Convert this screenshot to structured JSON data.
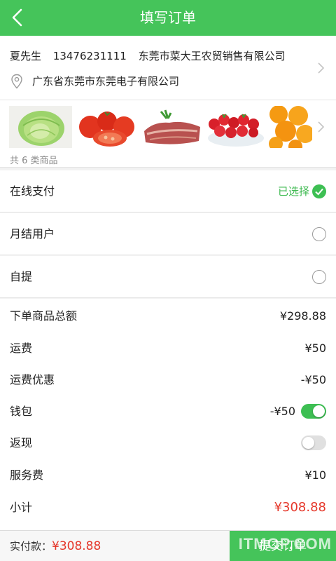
{
  "header": {
    "title": "填写订单",
    "back_icon": "chevron-left-icon"
  },
  "address": {
    "name": "夏先生",
    "phone": "13476231111",
    "company": "东莞市菜大王农贸销售有限公司",
    "location": "广东省东莞市东莞电子有限公司"
  },
  "goods": {
    "items": [
      "cabbage",
      "tomatoes",
      "pork",
      "strawberries",
      "oranges"
    ],
    "count_text": "共 6 类商品"
  },
  "payment_options": [
    {
      "label": "在线支付",
      "status": "已选择",
      "selected": true
    },
    {
      "label": "月结用户",
      "selected": false
    },
    {
      "label": "自提",
      "selected": false
    }
  ],
  "summary": {
    "total_label": "下单商品总额",
    "total_value": "¥298.88",
    "shipping_label": "运费",
    "shipping_value": "¥50",
    "shipping_discount_label": "运费优惠",
    "shipping_discount_value": "-¥50",
    "wallet_label": "钱包",
    "wallet_value": "-¥50",
    "wallet_enabled": true,
    "cashback_label": "返现",
    "cashback_enabled": false,
    "service_fee_label": "服务费",
    "service_fee_value": "¥10",
    "subtotal_label": "小计",
    "subtotal_value": "¥308.88"
  },
  "footer": {
    "pay_label": "实付款：",
    "pay_amount": "¥308.88",
    "submit_label": "提交订单",
    "watermark": "ITMOP.COM"
  },
  "colors": {
    "brand": "#45c45a",
    "price_red": "#e5372a"
  }
}
